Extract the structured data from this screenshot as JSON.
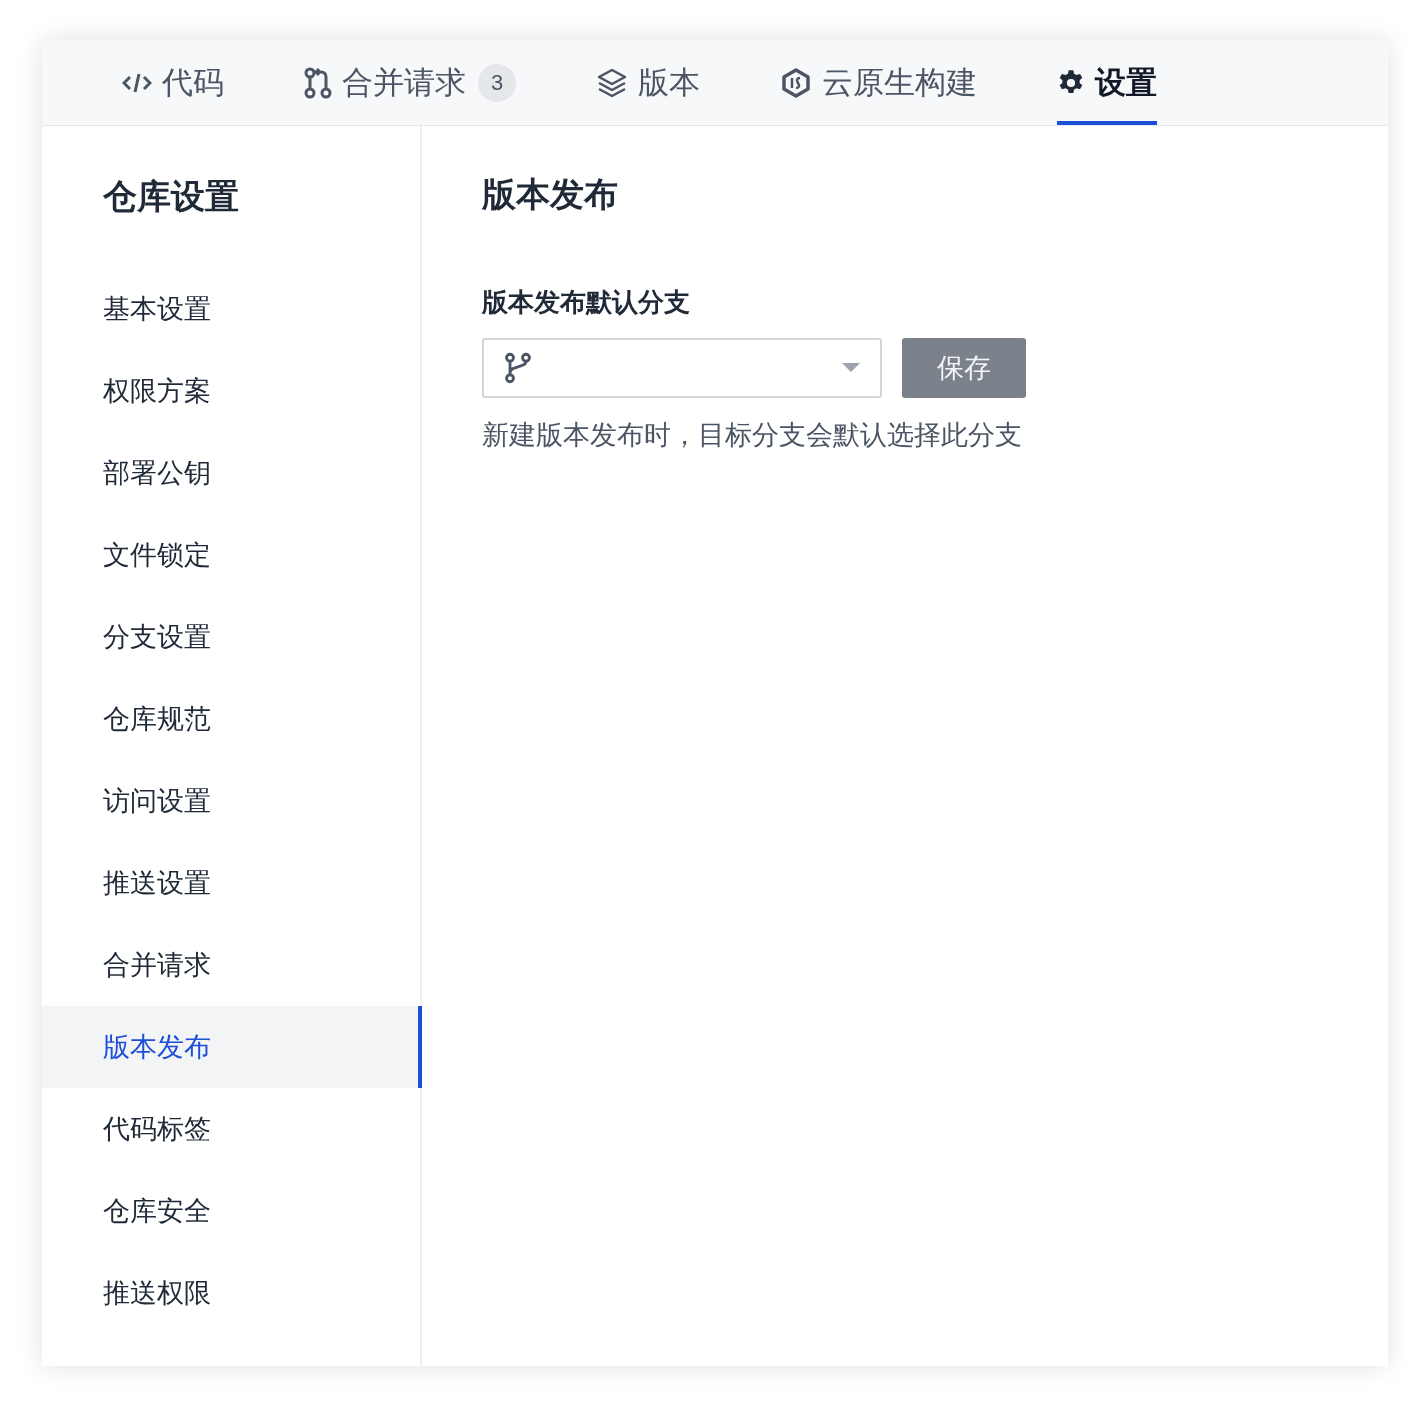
{
  "tabs": [
    {
      "label": "代码",
      "kind": "code",
      "selected": false
    },
    {
      "label": "合并请求",
      "kind": "merge",
      "badge": "3",
      "selected": false
    },
    {
      "label": "版本",
      "kind": "layers",
      "selected": false
    },
    {
      "label": "云原生构建",
      "kind": "build",
      "selected": false
    },
    {
      "label": "设置",
      "kind": "gear",
      "selected": true
    }
  ],
  "sidebar": {
    "title": "仓库设置",
    "items": [
      {
        "label": "基本设置",
        "selected": false
      },
      {
        "label": "权限方案",
        "selected": false
      },
      {
        "label": "部署公钥",
        "selected": false
      },
      {
        "label": "文件锁定",
        "selected": false
      },
      {
        "label": "分支设置",
        "selected": false
      },
      {
        "label": "仓库规范",
        "selected": false
      },
      {
        "label": "访问设置",
        "selected": false
      },
      {
        "label": "推送设置",
        "selected": false
      },
      {
        "label": "合并请求",
        "selected": false
      },
      {
        "label": "版本发布",
        "selected": true
      },
      {
        "label": "代码标签",
        "selected": false
      },
      {
        "label": "仓库安全",
        "selected": false
      },
      {
        "label": "推送权限",
        "selected": false
      }
    ]
  },
  "main": {
    "title": "版本发布",
    "field_label": "版本发布默认分支",
    "save_button": {
      "label": "保存",
      "disabled": true
    },
    "help": "新建版本发布时，目标分支会默认选择此分支"
  }
}
